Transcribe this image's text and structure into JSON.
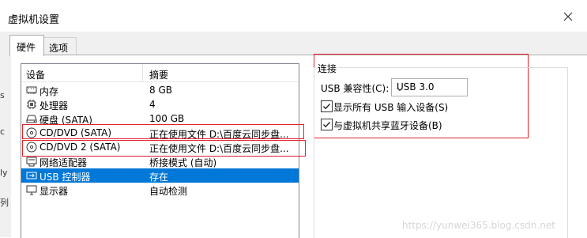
{
  "window": {
    "title": "虚拟机设置"
  },
  "tabs": [
    {
      "label": "硬件",
      "active": true
    },
    {
      "label": "选项",
      "active": false
    }
  ],
  "side_marks": [
    "s",
    "c",
    "ly",
    "列"
  ],
  "hardware_list": {
    "columns": [
      "设备",
      "摘要"
    ],
    "rows": [
      {
        "icon": "memory-icon",
        "name": "内存",
        "summary": "8 GB",
        "selected": false
      },
      {
        "icon": "cpu-icon",
        "name": "处理器",
        "summary": "4",
        "selected": false
      },
      {
        "icon": "hard-disk-icon",
        "name": "硬盘 (SATA)",
        "summary": "100 GB",
        "selected": false
      },
      {
        "icon": "cd-dvd-icon",
        "name": "CD/DVD (SATA)",
        "summary": "正在使用文件 D:\\百度云同步盘...",
        "selected": false
      },
      {
        "icon": "cd-dvd-icon",
        "name": "CD/DVD 2 (SATA)",
        "summary": "正在使用文件 D:\\百度云同步盘...",
        "selected": false
      },
      {
        "icon": "network-adapter-icon",
        "name": "网络适配器",
        "summary": "桥接模式 (自动)",
        "selected": false
      },
      {
        "icon": "usb-controller-icon",
        "name": "USB 控制器",
        "summary": "存在",
        "selected": true
      },
      {
        "icon": "display-icon",
        "name": "显示器",
        "summary": "自动检测",
        "selected": false
      }
    ]
  },
  "connection": {
    "group_title": "连接",
    "usb_compat_label": "USB 兼容性(C):",
    "usb_compat_value": "USB 3.0",
    "checkboxes": [
      {
        "label": "显示所有 USB 输入设备(S)",
        "checked": true
      },
      {
        "label": "与虚拟机共享蓝牙设备(B)",
        "checked": true
      }
    ]
  },
  "watermark": "https://yunwei365.blog.csdn.net",
  "colors": {
    "selection": "#0078d7",
    "annotation": "#e2222b"
  }
}
